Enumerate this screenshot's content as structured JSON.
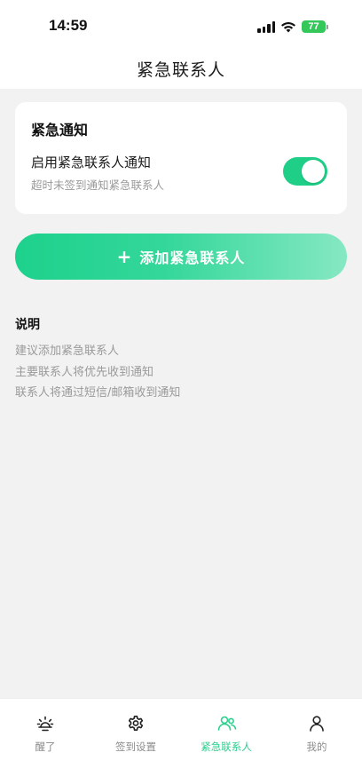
{
  "status": {
    "time": "14:59",
    "battery": "77"
  },
  "nav": {
    "title": "紧急联系人"
  },
  "card": {
    "title": "紧急通知",
    "row_title": "启用紧急联系人通知",
    "row_sub": "超时未签到通知紧急联系人",
    "toggle_on": true
  },
  "add_button": {
    "plus": "+",
    "label": "添加紧急联系人"
  },
  "notes": {
    "title": "说明",
    "items": [
      "建议添加紧急联系人",
      "主要联系人将优先收到通知",
      "联系人将通过短信/邮箱收到通知"
    ]
  },
  "tabs": [
    {
      "label": "醒了",
      "icon": "sun-icon"
    },
    {
      "label": "签到设置",
      "icon": "gear-icon"
    },
    {
      "label": "紧急联系人",
      "icon": "contacts-icon",
      "active": true
    },
    {
      "label": "我的",
      "icon": "person-icon"
    }
  ],
  "colors": {
    "accent": "#1fcf87",
    "background": "#f2f2f2"
  }
}
